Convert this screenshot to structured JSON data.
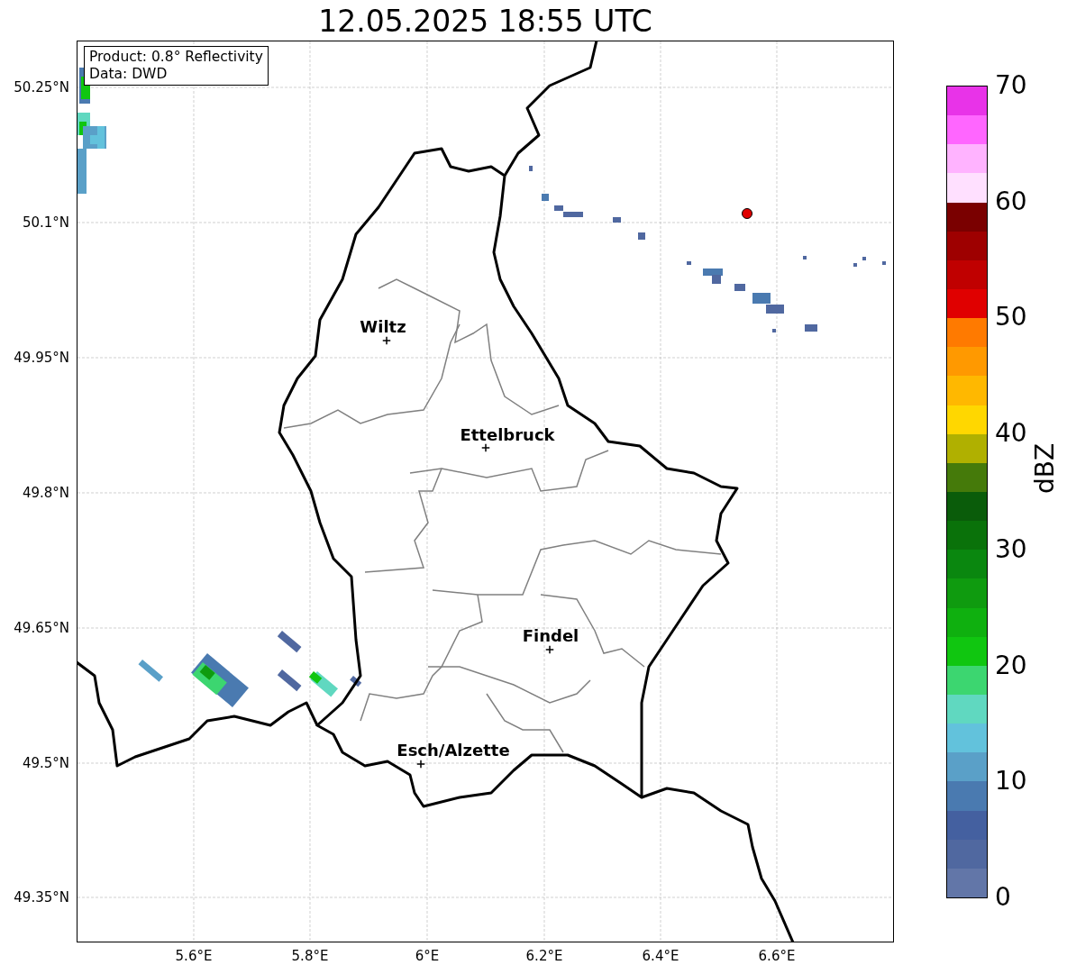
{
  "title": "12.05.2025 18:55 UTC",
  "legend": {
    "lines": [
      "Product: 0.8° Reflectivity",
      "Data: DWD"
    ]
  },
  "map": {
    "lat_ticks": [
      "50.25°N",
      "50.1°N",
      "49.95°N",
      "49.8°N",
      "49.65°N",
      "49.5°N",
      "49.35°N"
    ],
    "lon_ticks": [
      "5.6°E",
      "5.8°E",
      "6°E",
      "6.2°E",
      "6.4°E",
      "6.6°E"
    ],
    "cities": [
      {
        "name": "Wiltz"
      },
      {
        "name": "Ettelbruck"
      },
      {
        "name": "Findel"
      },
      {
        "name": "Esch/Alzette"
      }
    ]
  },
  "colorbar": {
    "label": "dBZ",
    "ticks": [
      "70",
      "60",
      "50",
      "40",
      "30",
      "20",
      "10",
      "0"
    ],
    "segments": [
      {
        "color": "#e833e8"
      },
      {
        "color": "#ff66ff"
      },
      {
        "color": "#ffb3ff"
      },
      {
        "color": "#ffe0ff"
      },
      {
        "color": "#7a0000"
      },
      {
        "color": "#9e0000"
      },
      {
        "color": "#c00000"
      },
      {
        "color": "#e00000"
      },
      {
        "color": "#ff7a00"
      },
      {
        "color": "#ff9900"
      },
      {
        "color": "#ffb800"
      },
      {
        "color": "#ffd700"
      },
      {
        "color": "#b0b000"
      },
      {
        "color": "#457a0a"
      },
      {
        "color": "#0a5c0a"
      },
      {
        "color": "#0a720a"
      },
      {
        "color": "#0a870f"
      },
      {
        "color": "#0f9b0f"
      },
      {
        "color": "#0fb00f"
      },
      {
        "color": "#10c610"
      },
      {
        "color": "#3cd670"
      },
      {
        "color": "#60d8c0"
      },
      {
        "color": "#62c2dc"
      },
      {
        "color": "#5aa0c8"
      },
      {
        "color": "#4a7ab0"
      },
      {
        "color": "#4460a0"
      },
      {
        "color": "#5068a0"
      },
      {
        "color": "#6276a8"
      }
    ]
  }
}
